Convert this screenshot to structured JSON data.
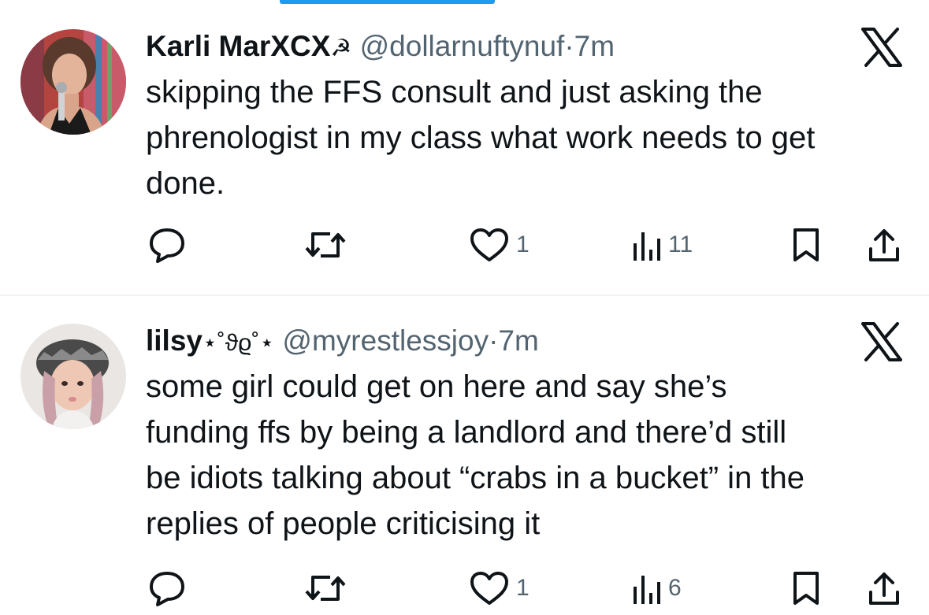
{
  "tweets": [
    {
      "display_name": "Karli MarXCX",
      "name_emoji": "☭",
      "handle": "@dollarnuftynuf",
      "separator": "·",
      "time": "7m",
      "text_lines": [
        "skipping the FFS consult and just asking the",
        "phrenologist in my class what work needs to get",
        "done."
      ],
      "reply_count": "",
      "retweet_count": "",
      "like_count": "1",
      "view_count": "11",
      "logo_icon": "x-logo-icon"
    },
    {
      "display_name": "lilsy",
      "name_emoji": "⋆˚ϑϱ˚⋆",
      "handle": "@myrestlessjoy",
      "separator": "·",
      "time": "7m",
      "text_lines": [
        "some girl could get on here and say she’s",
        "funding ffs by being a landlord and there’d still",
        "be idiots talking about “crabs in a bucket” in the",
        "replies of people criticising it"
      ],
      "reply_count": "",
      "retweet_count": "",
      "like_count": "1",
      "view_count": "6",
      "logo_icon": "x-logo-icon"
    }
  ],
  "colors": {
    "accent": "#1d9bf0",
    "text": "#0f1419",
    "secondary": "#536471",
    "divider": "#eff3f4"
  }
}
